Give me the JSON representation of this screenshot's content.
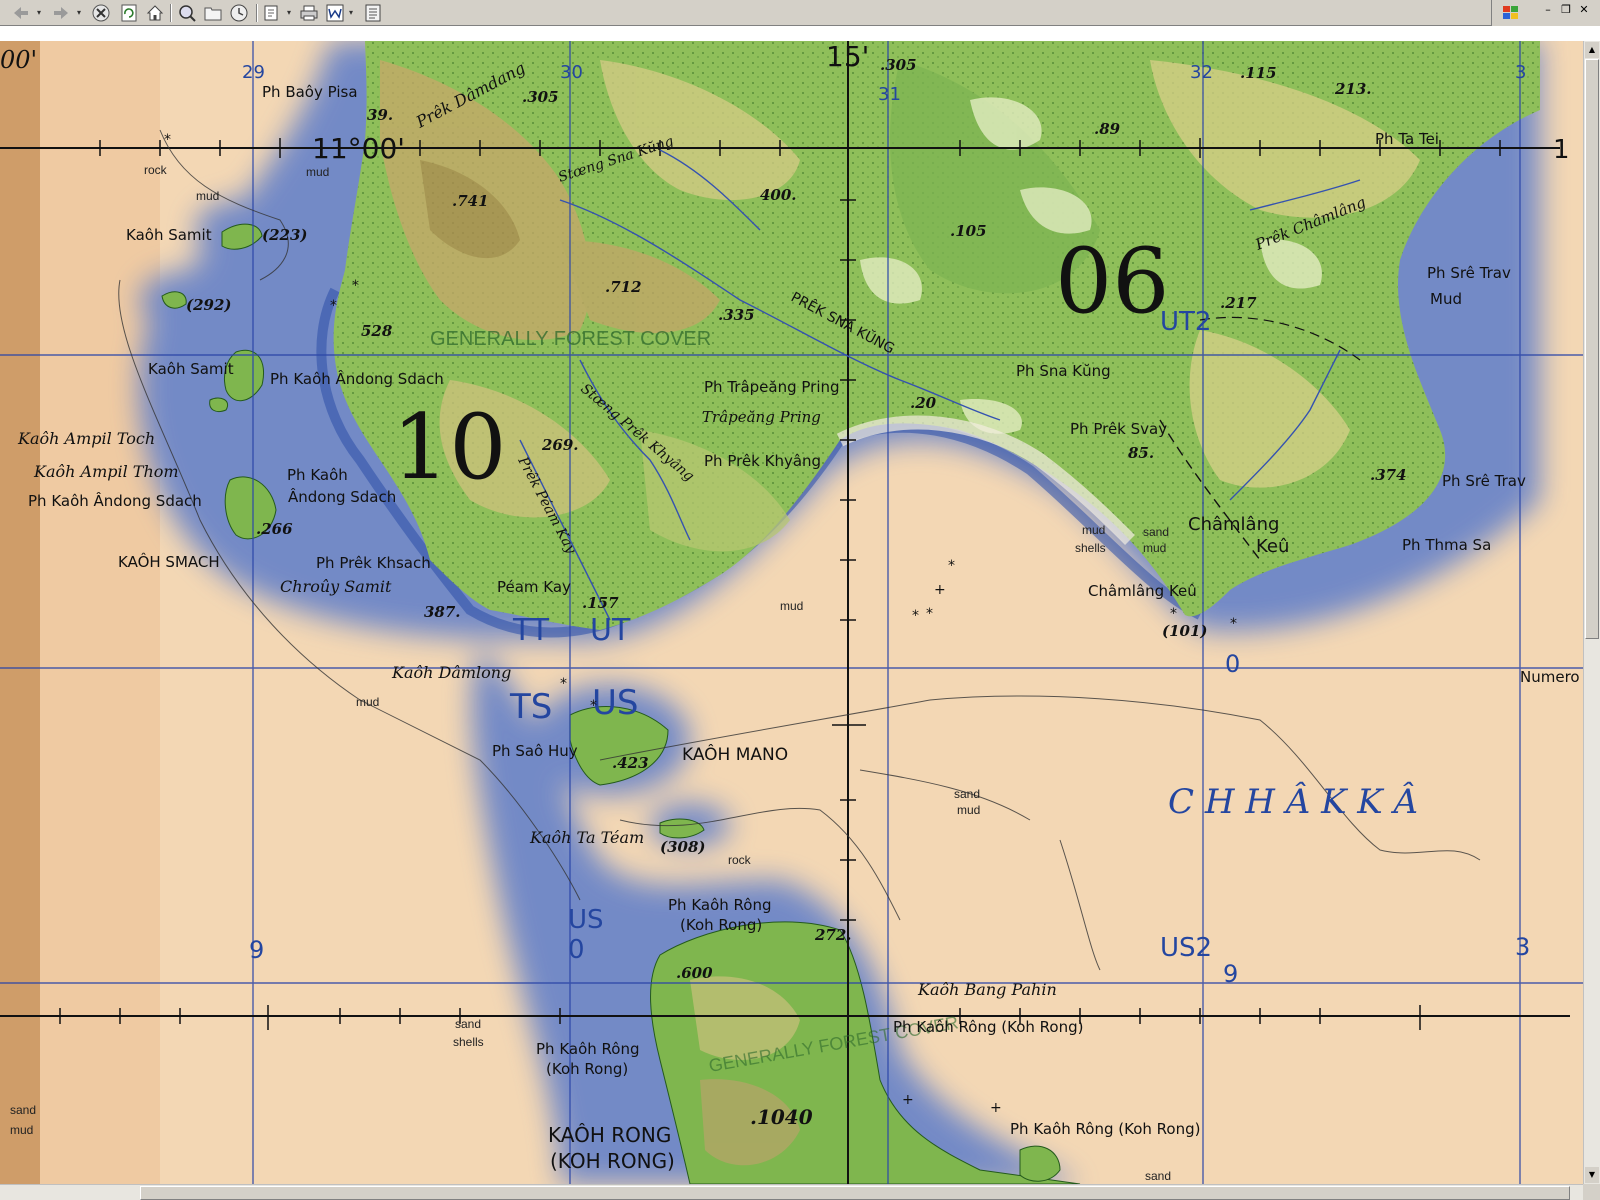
{
  "toolbar": {
    "icons": [
      "back-icon",
      "forward-icon",
      "stop-icon",
      "refresh-icon",
      "home-icon",
      "search-icon",
      "folder-icon",
      "history-icon",
      "edit-icon",
      "print-icon",
      "word-icon",
      "page-icon"
    ]
  },
  "map": {
    "top_labels": [
      "00'",
      "29",
      "30",
      "15'",
      "31",
      "32",
      "3"
    ],
    "lat_label": "11°00'",
    "lat_right": "1",
    "grid_06": "06",
    "grid_10": "10",
    "ut2": "UT2",
    "tt_ut_left": "TT",
    "tt_ut_right": "UT",
    "ts": "TS",
    "us": "US",
    "us_low": "US",
    "us_zero": "0",
    "us2": "US2",
    "nine_left": "9",
    "nine_right": "9",
    "zero_right": "0",
    "three_right": "3",
    "numero": "Numero",
    "forest_cover": "GENERALLY FOREST COVER",
    "forest_lower": "GENERALLY FOREST COVER",
    "chhak": "C H H Â K   K Â",
    "places": {
      "ph_baoy_pisa": "Ph Baôy Pisa",
      "prek_damdang": "Prêk Dâmdang",
      "ph_ta_tei": "Ph Ta Tei",
      "kaoh_samit": "Kaôh Samit",
      "kaoh_samit2": "Kaôh Samit",
      "ph_kaoh_andong": "Ph Kaôh Ândong Sdach",
      "kaoh_ampil_toch": "Kaôh Ampil Toch",
      "kaoh_ampil_thom": "Kaôh Ampil Thom",
      "ph_kaoh_andong_sdach": "Ph Kaôh Ândong Sdach",
      "ph_kaoh_andong_2a": "Ph Kaôh",
      "ph_kaoh_andong_2b": "Ândong Sdach",
      "kaoh_smach": "KAÔH SMACH",
      "ph_prek_khsach": "Ph Prêk Khsach",
      "chrouy_samit": "Chroûy Samit",
      "peam_kay": "Péam Kay",
      "kaoh_damlong": "Kaôh Dâmlong",
      "ph_sao_huy": "Ph Saô Huy",
      "kaoh_mano": "KAÔH MANO",
      "kaoh_ta_team": "Kaôh Ta Téam",
      "ph_kaoh_rong_a": "Ph Kaôh Rông",
      "ph_kaoh_rong_b": "(Koh Rong)",
      "kaoh_bang_pahin": "Kaôh Bang Pahin",
      "ph_kaoh_rong_koh": "Ph Kaôh Rông (Koh Rong)",
      "ph_kaoh_rong_left_a": "Ph Kaôh Rông",
      "ph_kaoh_rong_left_b": "(Koh Rong)",
      "ph_kaoh_rong_bottom": "Ph Kaôh Rông (Koh Rong)",
      "kaoh_rong_big_a": "KAÔH RONG",
      "kaoh_rong_big_b": "(KOH RONG)",
      "ph_trapeang_pring": "Ph Trâpeăng Pring",
      "trapeang_pring": "Trâpeăng Pring",
      "ph_prek_khyang": "Ph Prêk Khyâng",
      "ph_sna_kung": "Ph Sna Kŭng",
      "ph_prek_svay": "Ph Prêk Svay",
      "chamlang_keu_a": "Châmlâng",
      "chamlang_keu_b": "Keû",
      "chamlang_keu2": "Châmlâng Keû",
      "ph_sre_trav": "Ph Srê Trav",
      "ph_sre_trav2": "Ph Srê Trav",
      "mud_right": "Mud",
      "ph_thma_sa": "Ph Thma Sa",
      "prek_chamlang": "Prêk Châmlâng",
      "prek_sna_kung": "PRÊK SNA KŬNG",
      "stung_sna_kung": "Stœng Sna Kŭng",
      "stung_prek_khyang": "Stœng Prêk Khyâng",
      "prek_peam_kay": "Prêk Péam Kay"
    },
    "heights": {
      "h305a": ".305",
      "h305b": ".305",
      "h39": "39.",
      "h115": ".115",
      "h213": "213.",
      "h89": ".89",
      "h741": ".741",
      "h400": "400.",
      "h105": ".105",
      "h217": ".217",
      "h223": "(223)",
      "h292": "(292)",
      "h712": ".712",
      "h335": ".335",
      "h528": "528",
      "h269": "269.",
      "h20": ".20",
      "h85": "85.",
      "h374": ".374",
      "h266": ".266",
      "h157": ".157",
      "h387": "387.",
      "h101": "(101)",
      "h423": ".423",
      "h308": "(308)",
      "h272": "272.",
      "h600": ".600",
      "h1040": ".1040"
    },
    "notes": {
      "rock": "rock",
      "mud1": "mud",
      "mud2": "mud",
      "mud3": "mud",
      "mud4": "mud",
      "mud5": "mud",
      "mud6": "mud",
      "mud7": "mud",
      "mud8": "mud",
      "sand1": "sand",
      "sand2": "sand",
      "sand3": "sand",
      "sand4": "sand",
      "sand5": "sand",
      "shells1": "shells",
      "shells2": "shells",
      "rock2": "rock"
    }
  }
}
